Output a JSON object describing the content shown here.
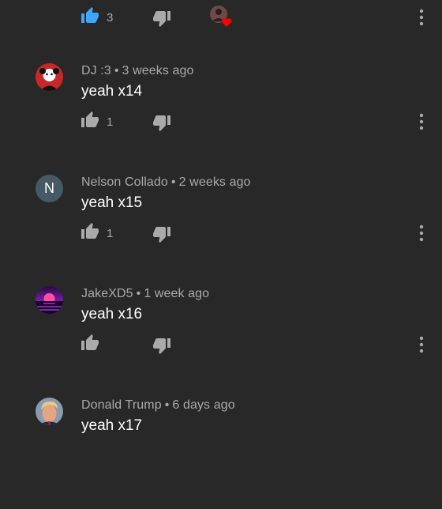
{
  "top_action_bar": {
    "like_count": "3",
    "like_active_color": "#3ea6ff",
    "icons": [
      "thumb-up-icon",
      "thumb-down-icon",
      "creator-heart-icon",
      "more-vert-icon"
    ]
  },
  "comments": [
    {
      "author": "DJ :3",
      "time": "3 weeks ago",
      "text": "yeah x14",
      "like_count": "1",
      "avatar": "red-character-avatar"
    },
    {
      "author": "Nelson Collado",
      "time": "2 weeks ago",
      "text": "yeah x15",
      "like_count": "1",
      "avatar_letter": "N",
      "avatar_color": "#455a64"
    },
    {
      "author": "JakeXD5",
      "time": "1 week ago",
      "text": "yeah x16",
      "like_count": "",
      "avatar": "synthwave-avatar"
    },
    {
      "author": "Donald Trump",
      "time": "6 days ago",
      "text": "yeah x17",
      "like_count": "",
      "avatar": "photo-avatar"
    }
  ],
  "separator": "•"
}
